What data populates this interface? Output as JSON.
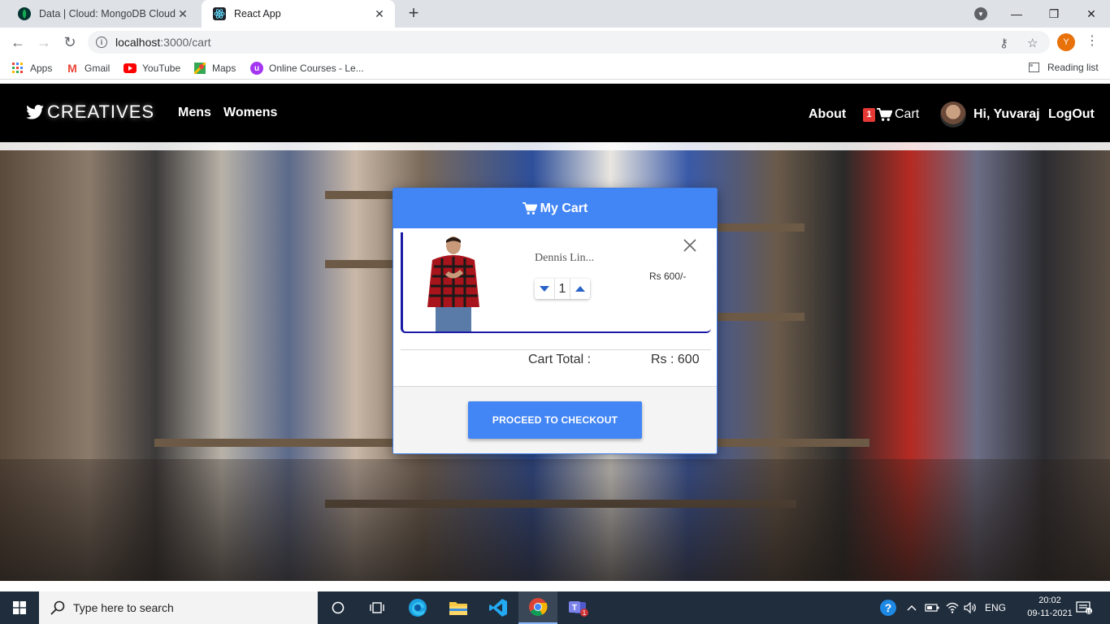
{
  "browser": {
    "tabs": [
      {
        "title": "Data | Cloud: MongoDB Cloud",
        "icon": "mongodb-leaf-icon",
        "active": false
      },
      {
        "title": "React App",
        "icon": "react-icon",
        "active": true
      }
    ],
    "url_host": "localhost",
    "url_path": ":3000/cart",
    "profile_initial": "Y",
    "bookmarks": [
      "Apps",
      "Gmail",
      "YouTube",
      "Maps",
      "Online Courses - Le..."
    ],
    "reading_list": "Reading list"
  },
  "site": {
    "brand": "CREATIVES",
    "nav_left": [
      "Mens",
      "Womens"
    ],
    "about": "About",
    "cart_count": "1",
    "cart_label": "Cart",
    "greeting": "Hi, Yuvaraj",
    "logout": "LogOut"
  },
  "cart": {
    "title": "My Cart",
    "items": [
      {
        "name": "Dennis Lin...",
        "quantity": "1",
        "price": "Rs 600/-"
      }
    ],
    "total_label": "Cart Total :",
    "total_value": "Rs : 600",
    "checkout_label": "PROCEED TO CHECKOUT"
  },
  "taskbar": {
    "search_placeholder": "Type here to search",
    "language": "ENG",
    "time": "20:02",
    "date": "09-11-2021"
  },
  "colors": {
    "accent": "#4285f4",
    "navbar": "#000000",
    "cart_badge": "#e53935",
    "item_border": "#1a1aa6"
  }
}
